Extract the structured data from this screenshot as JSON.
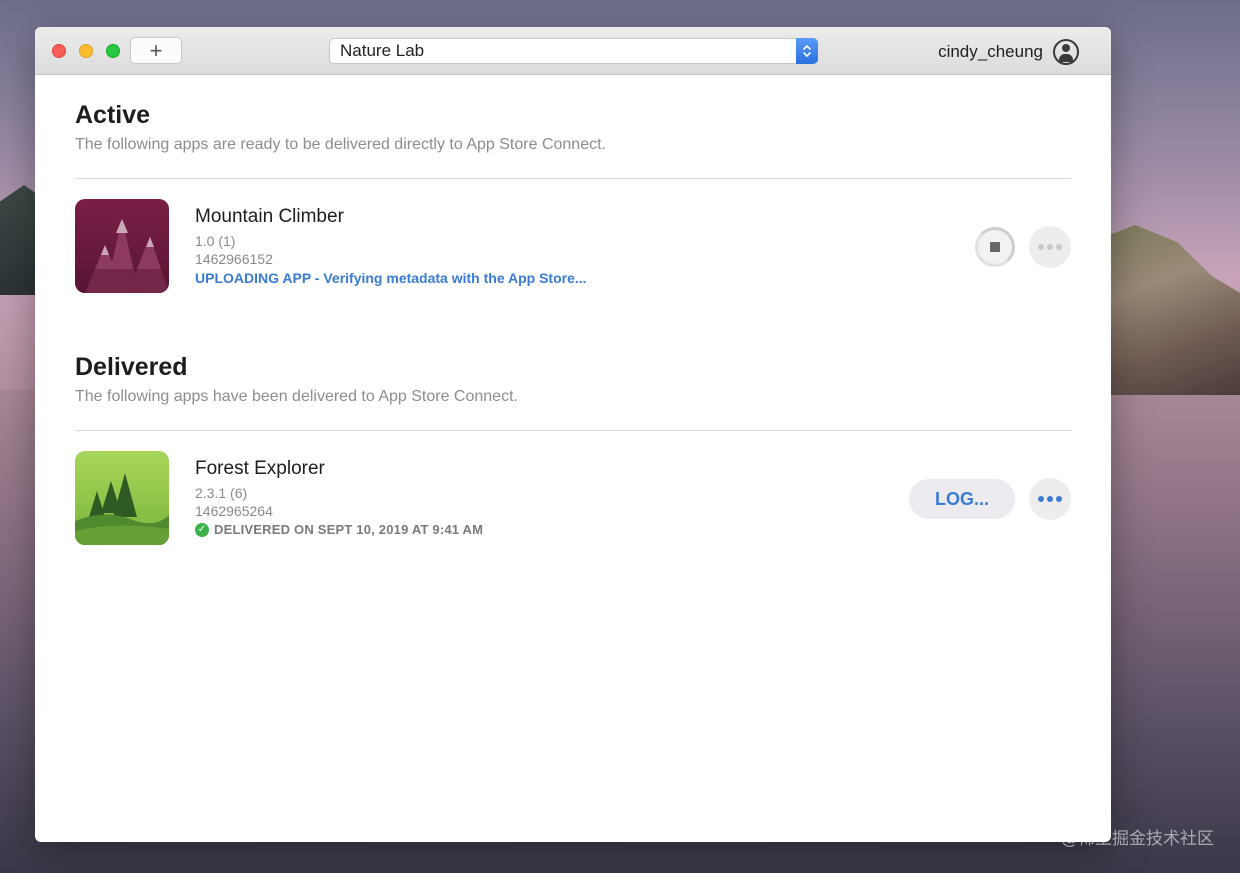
{
  "window": {
    "team_name": "Nature Lab",
    "account_name": "cindy_cheung",
    "add_label": "+"
  },
  "active": {
    "title": "Active",
    "subtitle": "The following apps are ready to be delivered directly to App Store Connect.",
    "apps": [
      {
        "name": "Mountain Climber",
        "version": "1.0 (1)",
        "app_id": "1462966152",
        "status": "UPLOADING APP - Verifying metadata with the App Store...",
        "icon": "mountain-app-icon"
      }
    ]
  },
  "delivered": {
    "title": "Delivered",
    "subtitle": "The following apps have been delivered to App Store Connect.",
    "apps": [
      {
        "name": "Forest Explorer",
        "version": "2.3.1 (6)",
        "app_id": "1462965264",
        "status": "DELIVERED ON SEPT 10, 2019 AT 9:41 AM",
        "log_label": "LOG...",
        "icon": "forest-app-icon"
      }
    ]
  },
  "watermark": "@稀土掘金技术社区",
  "colors": {
    "accent": "#3a7bd5",
    "success": "#3bb54a",
    "close": "#fc5f57",
    "minimize": "#fdbc2e",
    "maximize": "#28c840"
  }
}
